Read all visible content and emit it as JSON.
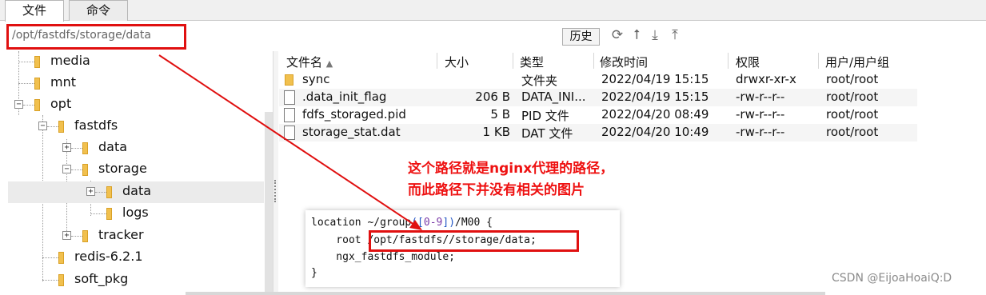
{
  "tabs": [
    {
      "label": "文件",
      "active": true
    },
    {
      "label": "命令",
      "active": false
    }
  ],
  "path": {
    "value": "/opt/fastdfs/storage/data"
  },
  "toolbar": {
    "history_label": "历史",
    "icons": [
      "refresh-icon",
      "up-icon",
      "download-icon",
      "upload-icon"
    ]
  },
  "tree": {
    "items": [
      {
        "label": "media"
      },
      {
        "label": "mnt"
      },
      {
        "label": "opt"
      },
      {
        "label": "fastdfs"
      },
      {
        "label": "data"
      },
      {
        "label": "storage"
      },
      {
        "label": "data"
      },
      {
        "label": "logs"
      },
      {
        "label": "tracker"
      },
      {
        "label": "redis-6.2.1"
      },
      {
        "label": "soft_pkg"
      }
    ]
  },
  "file_list": {
    "columns": [
      "文件名",
      "大小",
      "类型",
      "修改时间",
      "权限",
      "用户/用户组"
    ],
    "rows": [
      {
        "name": "sync",
        "size": "",
        "type": "文件夹",
        "modified": "2022/04/19 15:15",
        "perm": "drwxr-xr-x",
        "owner": "root/root"
      },
      {
        "name": ".data_init_flag",
        "size": "206 B",
        "type": "DATA_INI...",
        "modified": "2022/04/19 15:15",
        "perm": "-rw-r--r--",
        "owner": "root/root"
      },
      {
        "name": "fdfs_storaged.pid",
        "size": "5 B",
        "type": "PID 文件",
        "modified": "2022/04/20 08:49",
        "perm": "-rw-r--r--",
        "owner": "root/root"
      },
      {
        "name": "storage_stat.dat",
        "size": "1 KB",
        "type": "DAT 文件",
        "modified": "2022/04/20 10:49",
        "perm": "-rw-r--r--",
        "owner": "root/root"
      }
    ]
  },
  "annotation": {
    "line1": "这个路径就是nginx代理的路径，",
    "line2": "而此路径下并没有相关的图片",
    "color": "#ee1111"
  },
  "code": {
    "l1_a": "location ~/group",
    "l1_b": "([",
    "l1_c": "0-9",
    "l1_d": "])",
    "l1_e": "/M00 {",
    "l2_a": "    root ",
    "l2_b": "/opt/fastdfs//storage/data;",
    "l3": "    ngx_fastdfs_module;",
    "l4": "}"
  },
  "watermark": "CSDN @EijoaHoaiQ:D"
}
